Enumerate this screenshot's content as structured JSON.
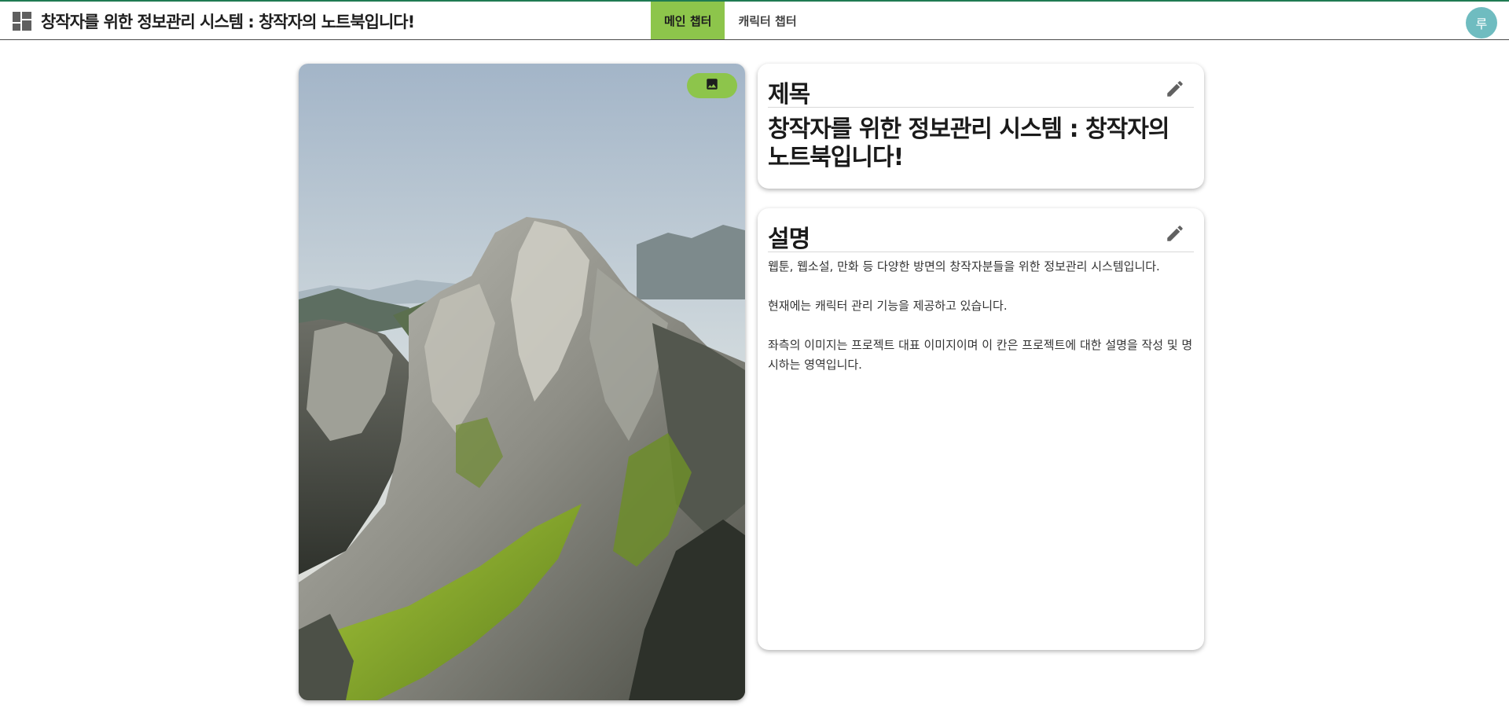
{
  "header": {
    "brand_icon": "dashboard-icon",
    "title": "창작자를 위한 정보관리 시스템 : 창작자의 노트북입니다!",
    "tabs": [
      {
        "label": "메인 챕터",
        "active": true
      },
      {
        "label": "캐릭터 챕터",
        "active": false
      }
    ],
    "avatar_initial": "루",
    "accent_color": "#8dc54b",
    "top_border_color": "#1f7a52",
    "avatar_color": "#6fbcc0"
  },
  "image_panel": {
    "image_button_icon": "image-icon",
    "image_subject": "mountain-landscape"
  },
  "title_card": {
    "label": "제목",
    "edit_icon": "pencil-icon",
    "value": "창작자를 위한 정보관리 시스템 : 창작자의 노트북입니다!"
  },
  "description_card": {
    "label": "설명",
    "edit_icon": "pencil-icon",
    "paragraphs": [
      "웹툰, 웹소설, 만화 등 다양한 방면의 창작자분들을 위한 정보관리 시스템입니다.",
      "현재에는 캐릭터 관리 기능을 제공하고 있습니다.",
      "좌측의 이미지는 프로젝트 대표 이미지이며 이 칸은 프로젝트에 대한 설명을 작성 및 명시하는 영역입니다."
    ]
  }
}
